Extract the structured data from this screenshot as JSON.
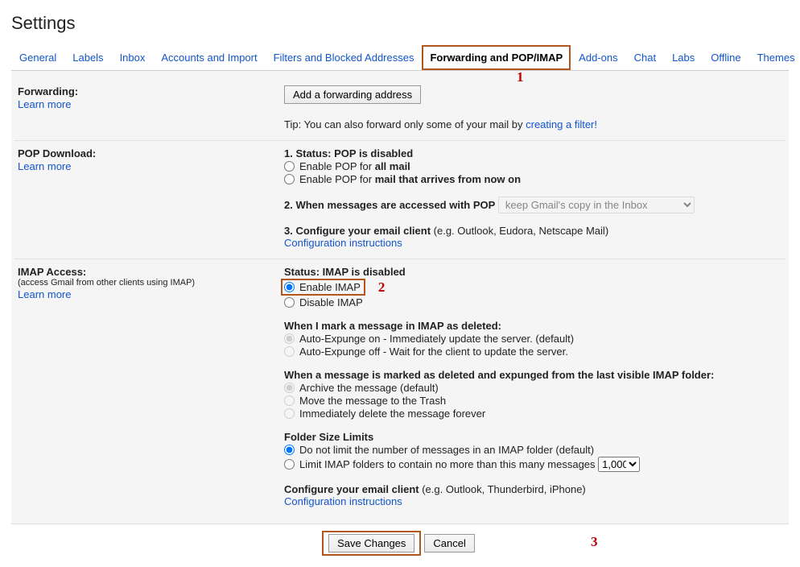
{
  "title": "Settings",
  "tabs": {
    "general": "General",
    "labels": "Labels",
    "inbox": "Inbox",
    "accounts": "Accounts and Import",
    "filters": "Filters and Blocked Addresses",
    "forwarding": "Forwarding and POP/IMAP",
    "addons": "Add-ons",
    "chat": "Chat",
    "labs": "Labs",
    "offline": "Offline",
    "themes": "Themes"
  },
  "annotations": {
    "one": "1",
    "two": "2",
    "three": "3"
  },
  "forwarding": {
    "label": "Forwarding:",
    "learn": "Learn more",
    "add_button": "Add a forwarding address",
    "tip_prefix": "Tip: You can also forward only some of your mail by ",
    "tip_link": "creating a filter!"
  },
  "pop": {
    "label": "POP Download:",
    "learn": "Learn more",
    "status_prefix": "1. Status: ",
    "status_value": "POP is disabled",
    "enable_all_prefix": "Enable POP for ",
    "enable_all_bold": "all mail",
    "enable_now_prefix": "Enable POP for ",
    "enable_now_bold": "mail that arrives from now on",
    "accessed_label": "2. When messages are accessed with POP",
    "accessed_select": "keep Gmail's copy in the Inbox",
    "configure_prefix": "3. Configure your email client ",
    "configure_eg": "(e.g. Outlook, Eudora, Netscape Mail)",
    "configure_link": "Configuration instructions"
  },
  "imap": {
    "label": "IMAP Access:",
    "sub": "(access Gmail from other clients using IMAP)",
    "learn": "Learn more",
    "status_prefix": "Status: ",
    "status_value": "IMAP is disabled",
    "enable": "Enable IMAP",
    "disable": "Disable IMAP",
    "deleted_header": "When I mark a message in IMAP as deleted:",
    "expunge_on": "Auto-Expunge on - Immediately update the server. (default)",
    "expunge_off": "Auto-Expunge off - Wait for the client to update the server.",
    "expunged_header": "When a message is marked as deleted and expunged from the last visible IMAP folder:",
    "archive": "Archive the message (default)",
    "trash": "Move the message to the Trash",
    "delete_forever": "Immediately delete the message forever",
    "folder_header": "Folder Size Limits",
    "no_limit": "Do not limit the number of messages in an IMAP folder (default)",
    "limit_prefix": "Limit IMAP folders to contain no more than this many messages",
    "limit_value": "1,000",
    "configure_prefix": "Configure your email client ",
    "configure_eg": "(e.g. Outlook, Thunderbird, iPhone)",
    "configure_link": "Configuration instructions"
  },
  "footer": {
    "save": "Save Changes",
    "cancel": "Cancel"
  }
}
